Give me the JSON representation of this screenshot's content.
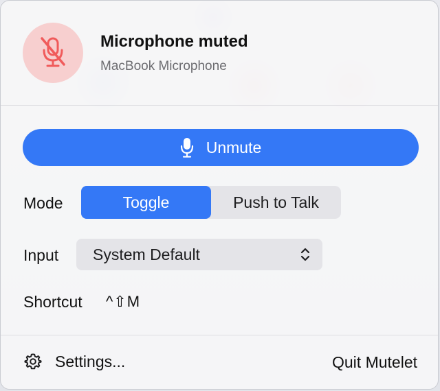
{
  "header": {
    "title": "Microphone muted",
    "subtitle": "MacBook Microphone",
    "status_icon": "microphone-slash-icon",
    "status_color": "#f05b5b",
    "status_bg": "#f7cfcf"
  },
  "unmute_button": {
    "label": "Unmute",
    "icon": "microphone-icon",
    "color": "#3478f6"
  },
  "mode": {
    "label": "Mode",
    "options": [
      "Toggle",
      "Push to Talk"
    ],
    "selected": "Toggle"
  },
  "input": {
    "label": "Input",
    "value": "System Default",
    "icon": "chevron-up-down-icon"
  },
  "shortcut": {
    "label": "Shortcut",
    "keys": "^⇧M"
  },
  "footer": {
    "settings_label": "Settings...",
    "settings_icon": "gear-icon",
    "quit_label": "Quit Mutelet"
  }
}
